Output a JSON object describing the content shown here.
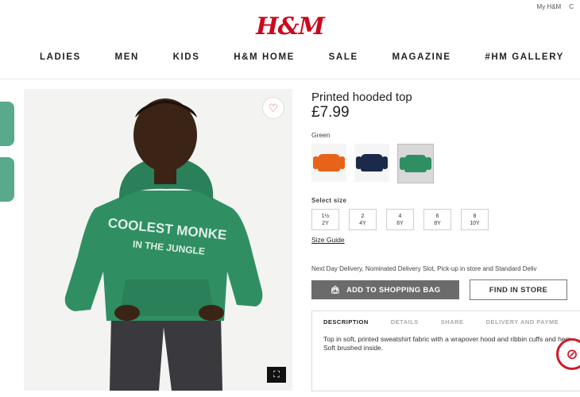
{
  "header": {
    "utility_links": [
      "My H&M",
      "C"
    ],
    "logo": "H&M",
    "nav": [
      "LADIES",
      "MEN",
      "KIDS",
      "H&M HOME",
      "SALE",
      "MAGAZINE",
      "#HM GALLERY"
    ]
  },
  "product": {
    "title": "Printed hooded top",
    "price": "£7.99",
    "color_label": "Green",
    "swatches": [
      {
        "name": "orange",
        "color": "#e8631a"
      },
      {
        "name": "navy",
        "color": "#1b2a4a"
      },
      {
        "name": "green",
        "color": "#2f8f63",
        "selected": true
      }
    ],
    "image_print_text": "COOLEST MONKE\nIN THE JUNGLE",
    "select_size_label": "Select size",
    "sizes": [
      {
        "top": "1½",
        "bottom": "2Y"
      },
      {
        "top": "2",
        "bottom": "4Y"
      },
      {
        "top": "4",
        "bottom": "6Y"
      },
      {
        "top": "6",
        "bottom": "8Y"
      },
      {
        "top": "8",
        "bottom": "10Y"
      }
    ],
    "size_guide_label": "Size Guide",
    "delivery_text": "Next Day Delivery, Nominated Delivery Slot, Pick-up in store and Standard Deliv",
    "add_to_bag_label": "ADD TO SHOPPING BAG",
    "find_in_store_label": "FIND IN STORE",
    "tabs": [
      "DESCRIPTION",
      "DETAILS",
      "SHARE",
      "DELIVERY AND PAYME"
    ],
    "description": "Top in soft, printed sweatshirt fabric with a wrapover hood and ribbin cuffs and hem. Soft brushed inside."
  },
  "colors": {
    "brand": "#cc071e",
    "hoodie": "#2f8f63"
  }
}
